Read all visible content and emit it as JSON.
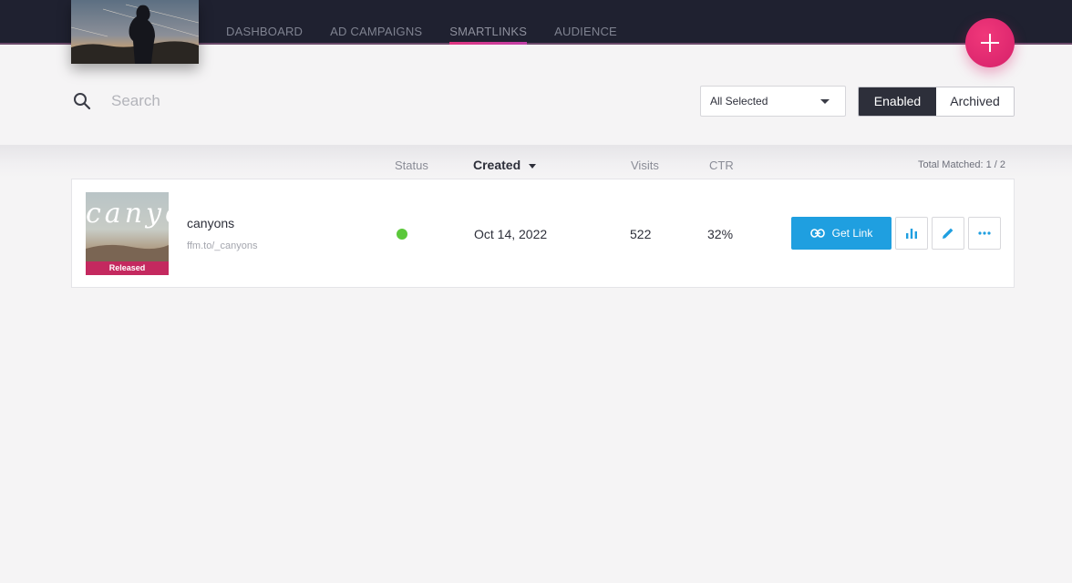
{
  "nav": {
    "items": [
      {
        "label": "DASHBOARD",
        "active": false
      },
      {
        "label": "AD CAMPAIGNS",
        "active": false
      },
      {
        "label": "SMARTLINKS",
        "active": true
      },
      {
        "label": "AUDIENCE",
        "active": false
      }
    ]
  },
  "colors": {
    "topbar": "#1f2130",
    "accent_pink": "#e0357f",
    "link_blue": "#1f9fe0",
    "status_green": "#5bc83a"
  },
  "icons": {
    "fab": "plus-icon",
    "search": "search-icon",
    "link": "link-icon",
    "stats": "bar-chart-icon",
    "edit": "pencil-icon",
    "more": "more-horizontal-icon"
  },
  "search": {
    "placeholder": "Search",
    "value": ""
  },
  "filter": {
    "selected": "All Selected"
  },
  "toggle": {
    "enabled_label": "Enabled",
    "archived_label": "Archived",
    "active": "Enabled"
  },
  "table": {
    "headers": {
      "status": "Status",
      "created": "Created",
      "visits": "Visits",
      "ctr": "CTR"
    },
    "total_matched": "Total Matched: 1 / 2",
    "rows": [
      {
        "title": "canyons",
        "url": "ffm.to/_canyons",
        "cover_text": "canyons",
        "badge": "Released",
        "status": "active",
        "created": "Oct 14, 2022",
        "visits": "522",
        "ctr": "32%",
        "get_link_label": "Get Link"
      }
    ]
  }
}
